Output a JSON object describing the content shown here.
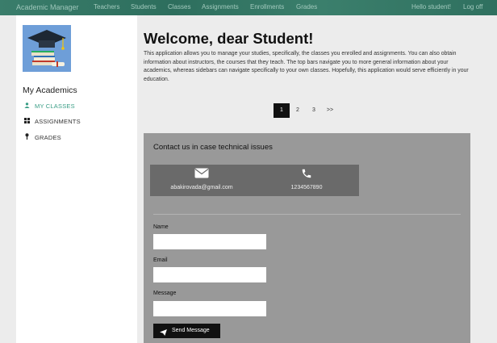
{
  "navbar": {
    "brand": "Academic Manager",
    "links": [
      "Teachers",
      "Students",
      "Classes",
      "Assignments",
      "Enrollments",
      "Grades"
    ],
    "greeting": "Hello student!",
    "logout": "Log off"
  },
  "sidebar": {
    "title": "My Academics",
    "items": [
      {
        "label": "MY CLASSES",
        "icon": "user-icon",
        "active": true
      },
      {
        "label": "ASSIGNMENTS",
        "icon": "grid-icon",
        "active": false
      },
      {
        "label": "GRADES",
        "icon": "pin-icon",
        "active": false
      }
    ]
  },
  "main": {
    "title": "Welcome, dear Student!",
    "intro": "This application allows you to manage your studies, specifically, the classes you enrolled and assignments. You can also obtain information about instructors, the courses that they teach. The top bars navigate you to more general information about your academics, whereas sidebars can navigate specifically to your own classes. Hopefully, this application would serve efficiently in your education."
  },
  "pagination": {
    "pages": [
      "1",
      "2",
      "3",
      ">>"
    ],
    "current": "1"
  },
  "contact": {
    "title": "Contact us in case technical issues",
    "email": "abakirovada@gmail.com",
    "phone": "1234567890",
    "name_label": "Name",
    "email_label": "Email",
    "message_label": "Message",
    "send_label": "Send Message"
  },
  "colors": {
    "navbar": "#3a7d6b",
    "accent": "#3a9e86",
    "contact_bg": "#999999",
    "info_box": "#6a6a6a"
  }
}
